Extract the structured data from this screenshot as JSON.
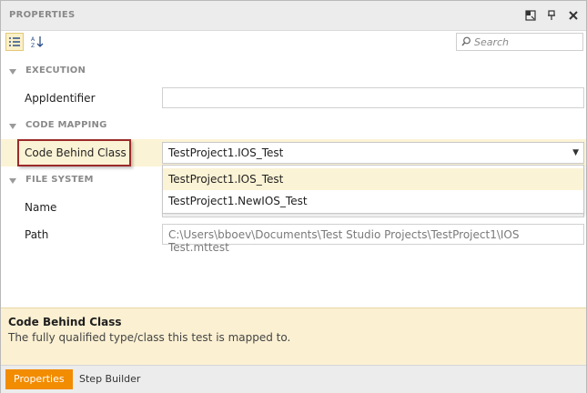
{
  "panel": {
    "title": "PROPERTIES",
    "icons": [
      "float-icon",
      "pin-icon",
      "close-icon"
    ]
  },
  "toolbar": {
    "categorized_icon": "categorized-view-icon",
    "alphabetical_icon": "sort-alphabetical-icon"
  },
  "search": {
    "placeholder": "Search",
    "icon": "search-icon"
  },
  "categories": {
    "execution": "EXECUTION",
    "code_mapping": "CODE MAPPING",
    "file_system": "FILE SYSTEM"
  },
  "properties": {
    "app_identifier": {
      "label": "AppIdentifier",
      "value": ""
    },
    "code_behind_class": {
      "label": "Code Behind Class",
      "value": "TestProject1.IOS_Test"
    },
    "name": {
      "label": "Name",
      "value": ""
    },
    "path": {
      "label": "Path",
      "value": "C:\\Users\\bboev\\Documents\\Test Studio Projects\\TestProject1\\IOS Test.mttest"
    }
  },
  "dropdown": {
    "options": [
      "TestProject1.IOS_Test",
      "TestProject1.NewIOS_Test"
    ],
    "selected_index": 0
  },
  "description": {
    "heading": "Code Behind Class",
    "text": "The fully qualified type/class this test is mapped to."
  },
  "bottom_tabs": [
    {
      "label": "Properties",
      "active": true
    },
    {
      "label": "Step Builder",
      "active": false
    }
  ],
  "colors": {
    "accent": "#f28c00",
    "highlight": "#fbf3d5",
    "callout_border": "#9b2a2a"
  }
}
